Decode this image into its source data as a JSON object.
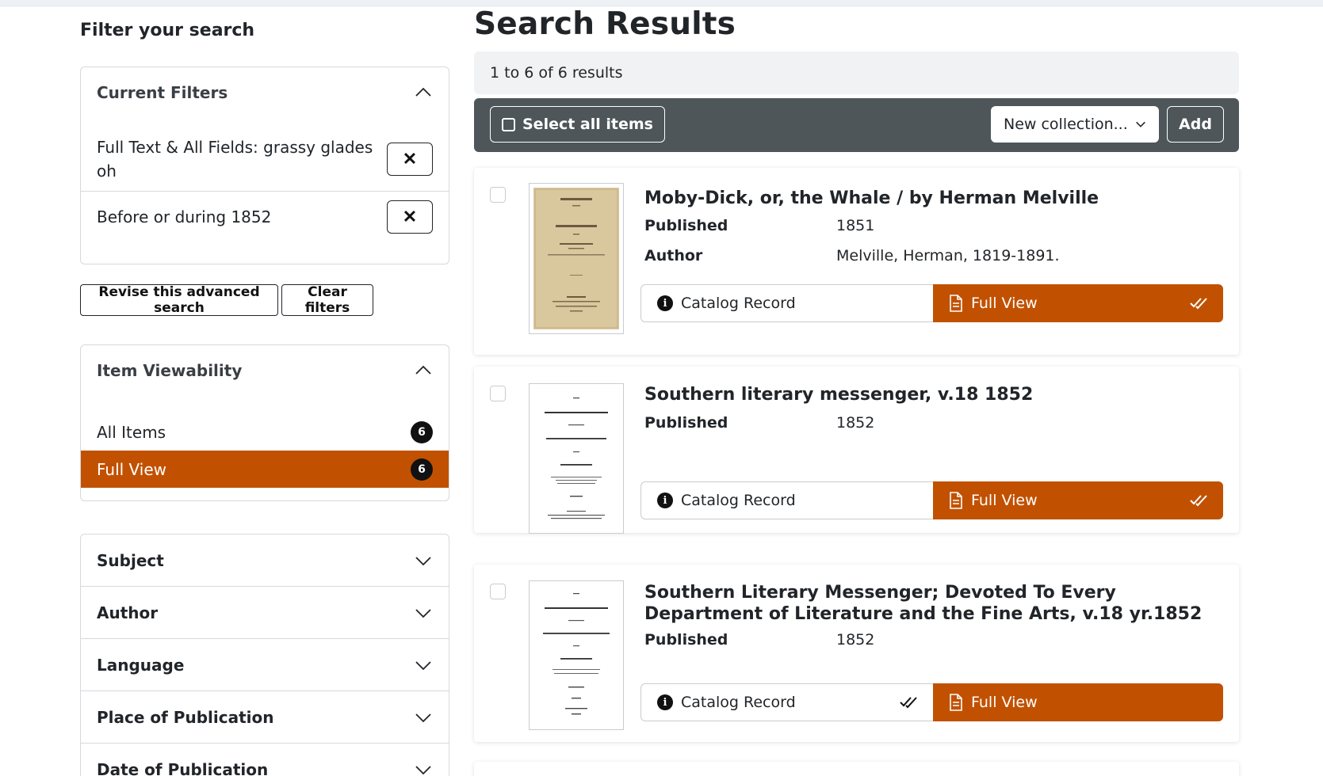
{
  "sidebar": {
    "heading": "Filter your search",
    "current_filters": {
      "title": "Current Filters",
      "items": [
        {
          "label": "Full Text & All Fields: grassy glades oh",
          "remove": "✕"
        },
        {
          "label": "Before or during 1852",
          "remove": "✕"
        }
      ]
    },
    "revise_label": "Revise this advanced search",
    "clear_label": "Clear filters",
    "viewability": {
      "title": "Item Viewability",
      "items": [
        {
          "label": "All Items",
          "count": "6",
          "active": false
        },
        {
          "label": "Full View",
          "count": "6",
          "active": true
        }
      ]
    },
    "facets": [
      "Subject",
      "Author",
      "Language",
      "Place of Publication",
      "Date of Publication"
    ]
  },
  "main": {
    "title": "Search Results",
    "results_summary": "1 to 6 of 6 results",
    "toolbar": {
      "select_all": "Select all items",
      "collection_select": "New collection...",
      "add": "Add"
    },
    "results": [
      {
        "title": "Moby-Dick, or, the Whale / by Herman Melville",
        "fields": [
          {
            "key": "Published",
            "value": "1851"
          },
          {
            "key": "Author",
            "value": "Melville, Herman, 1819-1891."
          }
        ],
        "catalog_label": "Catalog Record",
        "fullview_label": "Full View",
        "checked": "fullview"
      },
      {
        "title": "Southern literary messenger, v.18 1852",
        "fields": [
          {
            "key": "Published",
            "value": "1852"
          }
        ],
        "catalog_label": "Catalog Record",
        "fullview_label": "Full View",
        "checked": "fullview"
      },
      {
        "title": "Southern Literary Messenger; Devoted To Every Department of Literature and the Fine Arts, v.18 yr.1852",
        "fields": [
          {
            "key": "Published",
            "value": "1852"
          }
        ],
        "catalog_label": "Catalog Record",
        "fullview_label": "Full View",
        "checked": "catalog"
      }
    ]
  },
  "colors": {
    "accent": "#c15100",
    "toolbar": "#4e5659",
    "badge": "#111111"
  },
  "icons": [
    "chevron-up-icon",
    "chevron-down-icon",
    "close-icon",
    "checkbox-icon",
    "info-icon",
    "document-icon",
    "double-check-icon"
  ]
}
